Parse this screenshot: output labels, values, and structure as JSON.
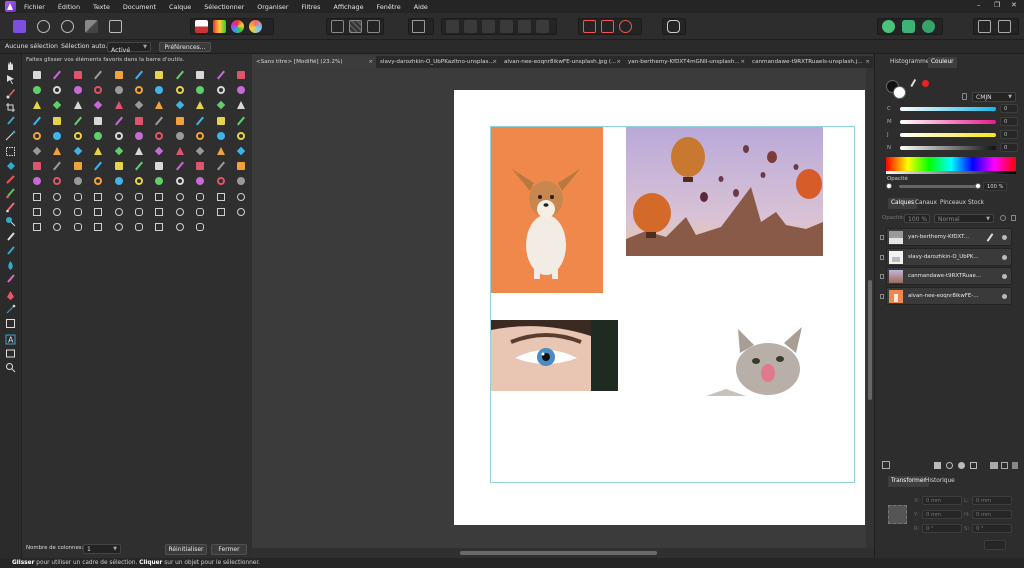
{
  "menu": [
    "Fichier",
    "Édition",
    "Texte",
    "Document",
    "Calque",
    "Sélectionner",
    "Organiser",
    "Filtres",
    "Affichage",
    "Fenêtre",
    "Aide"
  ],
  "window_controls": [
    "–",
    "❐",
    "✕"
  ],
  "context": {
    "no_selection": "Aucune sélection",
    "auto_select_label": "Sélection auto.:",
    "auto_select_value": "Activé",
    "preferences_button": "Préférences..."
  },
  "customize": {
    "hint": "Faites glisser vos éléments favoris dans la barre d'outils.",
    "columns_label": "Nombre de colonnes:",
    "columns_value": "1",
    "reset_button": "Réinitialiser",
    "close_button": "Fermer"
  },
  "tabs": [
    "<Sans titre> [Modifié] (23.2%)",
    "slavy-darozhkin-O_UbPKazltno-unsplas...",
    "alvan-nee-eoqnr8ikwFE-unsplash.jpg (...",
    "yan-berthemy-KfDXT4mGNIl-unsplash...",
    "canmandawe-t9RXTRuaeIs-unsplash.j..."
  ],
  "right_panel": {
    "top_tabs": [
      "Histogramme",
      "Couleur"
    ],
    "color_model": "CMJN",
    "channels": [
      "C",
      "M",
      "J",
      "N"
    ],
    "channel_values": [
      "0",
      "0",
      "0",
      "0"
    ],
    "opacity_label": "Opacité",
    "opacity_value": "100 %",
    "layer_tabs": [
      "Calques",
      "Canaux",
      "Pinceaux",
      "Stock"
    ],
    "layer_opacity_label": "Opacité:",
    "layer_opacity_value": "100 %",
    "blend_mode": "Normal",
    "layers": [
      "yan-berthemy-KfDXT...",
      "slavy-darozhkin-O_UbPK...",
      "canmandawe-t9RXTRuae...",
      "alvan-nee-eoqnr8ikwFE-..."
    ],
    "transform_tabs": [
      "Transformer",
      "Historique"
    ],
    "transform_fields": [
      {
        "label": "X:",
        "value": "0 mm"
      },
      {
        "label": "L:",
        "value": "0 mm"
      },
      {
        "label": "Y:",
        "value": "0 mm"
      },
      {
        "label": "H:",
        "value": "0 mm"
      },
      {
        "label": "R:",
        "value": "0 °"
      },
      {
        "label": "S:",
        "value": "0 °"
      }
    ]
  },
  "status": {
    "bold1": "Glisser",
    "text1": " pour utiliser un cadre de sélection. ",
    "bold2": "Cliquer",
    "text2": " sur un objet pour le sélectionner."
  }
}
